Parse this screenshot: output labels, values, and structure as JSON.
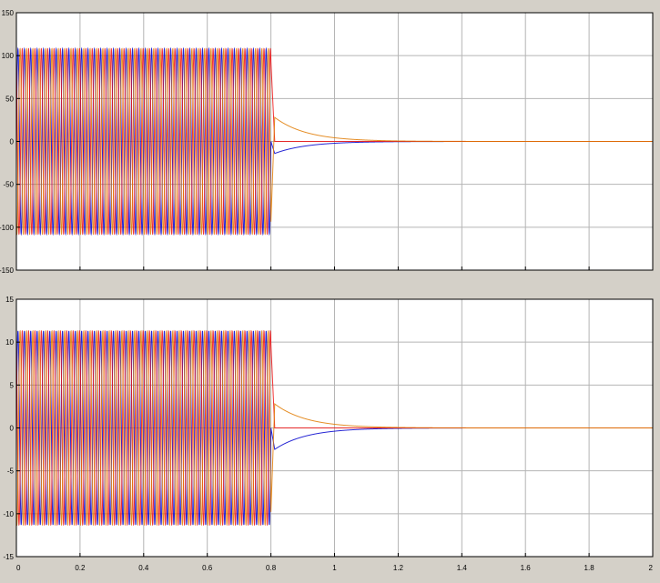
{
  "chart_data": [
    {
      "type": "line",
      "title": "",
      "xlabel": "",
      "ylabel": "",
      "xlim": [
        0,
        2
      ],
      "ylim": [
        -150,
        150
      ],
      "x_ticks": [
        0,
        0.2,
        0.4,
        0.6,
        0.8,
        1,
        1.2,
        1.4,
        1.6,
        1.8,
        2
      ],
      "y_ticks": [
        150,
        100,
        50,
        0,
        -50,
        -100,
        -150
      ],
      "y_tick_labels": [
        "150",
        "100",
        "50",
        "0",
        "-50",
        "-100",
        "-150"
      ],
      "show_x_tick_labels": false,
      "grid": true,
      "series": [
        {
          "color": "#0000cc",
          "amplitude": 108,
          "phase_deg": 0,
          "decay_start": -14
        },
        {
          "color": "#ee1111",
          "amplitude": 108,
          "phase_deg": 120,
          "decay_start": 0
        },
        {
          "color": "#e07a00",
          "amplitude": 108,
          "phase_deg": 240,
          "decay_start": 28
        }
      ],
      "fault_time": 0.8,
      "frequency_hz": 50,
      "decay_tau": 0.1
    },
    {
      "type": "line",
      "title": "",
      "xlabel": "",
      "ylabel": "",
      "xlim": [
        0,
        2
      ],
      "ylim": [
        -15,
        15
      ],
      "x_ticks": [
        0,
        0.2,
        0.4,
        0.6,
        0.8,
        1,
        1.2,
        1.4,
        1.6,
        1.8,
        2
      ],
      "x_tick_labels": [
        "0",
        "0.2",
        "0.4",
        "0.6",
        "0.8",
        "1",
        "1.2",
        "1.4",
        "1.6",
        "1.8",
        "2"
      ],
      "y_ticks": [
        15,
        10,
        5,
        0,
        -5,
        -10,
        -15
      ],
      "y_tick_labels": [
        "15",
        "10",
        "5",
        "0",
        "-5",
        "-10",
        "-15"
      ],
      "show_x_tick_labels": true,
      "grid": true,
      "series": [
        {
          "color": "#0000cc",
          "amplitude": 11.3,
          "phase_deg": 0,
          "decay_start": -2.5
        },
        {
          "color": "#ee1111",
          "amplitude": 11.3,
          "phase_deg": 120,
          "decay_start": 0
        },
        {
          "color": "#e07a00",
          "amplitude": 11.3,
          "phase_deg": 240,
          "decay_start": 2.8
        }
      ],
      "fault_time": 0.8,
      "frequency_hz": 50,
      "decay_tau": 0.1
    }
  ]
}
